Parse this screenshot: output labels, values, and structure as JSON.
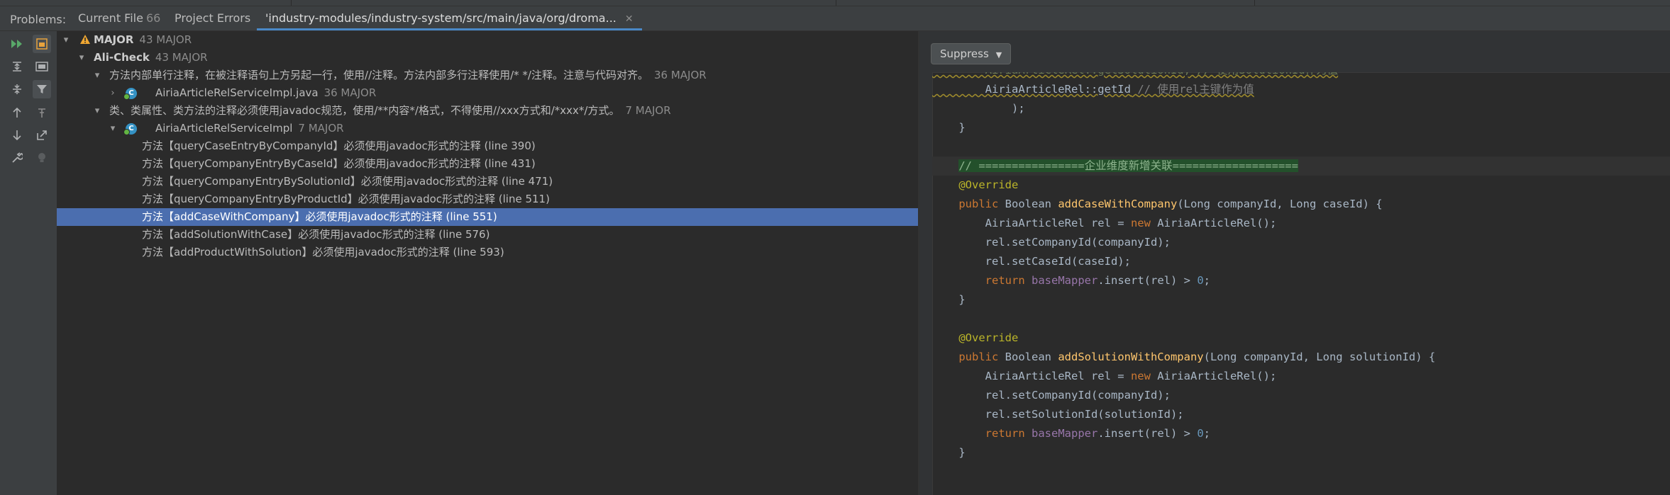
{
  "tabs": {
    "problems_label": "Problems:",
    "current_file": {
      "label": "Current File",
      "count": "66"
    },
    "project_errors": {
      "label": "Project Errors"
    },
    "path_tab": {
      "label": "'industry-modules/industry-system/src/main/java/org/droma...",
      "close": "✕"
    }
  },
  "toolbar": {
    "buttons": [
      "run-icon",
      "preview-icon",
      "expand-all-icon",
      "group-icon",
      "collapse-all-icon",
      "filter-icon",
      "prev-problem-icon",
      "pin-icon",
      "next-problem-icon",
      "export-icon",
      "settings-icon",
      "bulb-icon"
    ]
  },
  "tree": {
    "severity": {
      "label": "MAJOR",
      "count": "43 MAJOR"
    },
    "inspection": {
      "label": "Ali-Check",
      "count": "43 MAJOR"
    },
    "rule1": {
      "label": "方法内部单行注释，在被注释语句上方另起一行，使用//注释。方法内部多行注释使用/* */注释。注意与代码对齐。",
      "count": "36 MAJOR"
    },
    "rule1_file": {
      "label": "AiriaArticleRelServiceImpl.java",
      "count": "36 MAJOR"
    },
    "rule2": {
      "label": "类、类属性、类方法的注释必须使用javadoc规范，使用/**内容*/格式，不得使用//xxx方式和/*xxx*/方式。",
      "count": "7 MAJOR"
    },
    "rule2_class": {
      "label": "AiriaArticleRelServiceImpl",
      "count": "7 MAJOR"
    },
    "problems": [
      {
        "label": "方法【queryCaseEntryByCompanyId】必须使用javadoc形式的注释 (line 390)"
      },
      {
        "label": "方法【queryCompanyEntryByCaseId】必须使用javadoc形式的注释 (line 431)"
      },
      {
        "label": "方法【queryCompanyEntryBySolutionId】必须使用javadoc形式的注释 (line 471)"
      },
      {
        "label": "方法【queryCompanyEntryByProductId】必须使用javadoc形式的注释 (line 511)"
      },
      {
        "label": "方法【addCaseWithCompany】必须使用javadoc形式的注释 (line 551)"
      },
      {
        "label": "方法【addSolutionWithCase】必须使用javadoc形式的注释 (line 576)"
      },
      {
        "label": "方法【addProductWithSolution】必须使用javadoc形式的注释 (line 593)"
      }
    ],
    "selected_index": 4
  },
  "editor": {
    "suppress_label": "Suppress",
    "code": {
      "l0_a": "        AiriaArticleRel::getSolutionId, // 使用SolutionId作为值",
      "l1_a": "        AiriaArticleRel::getId",
      "l1_b": "// 使用rel主键作为值",
      "l2": "    );",
      "l3": "}",
      "l5": "// ================企业维度新增关联===================",
      "l6": "@Override",
      "l7_kw": "public",
      "l7_type": " Boolean ",
      "l7_fn": "addCaseWithCompany",
      "l7_args": "(Long companyId, Long caseId) {",
      "l8_a": "    AiriaArticleRel rel = ",
      "l8_kw": "new",
      "l8_b": " AiriaArticleRel();",
      "l9": "    rel.setCompanyId(companyId);",
      "l10": "    rel.setCaseId(caseId);",
      "l11_kw": "return",
      "l11_fld": "baseMapper",
      "l11_b": ".insert(rel) > ",
      "l11_num": "0",
      "l11_end": ";",
      "l12": "}",
      "l14": "@Override",
      "l15_kw": "public",
      "l15_type": " Boolean ",
      "l15_fn": "addSolutionWithCompany",
      "l15_args": "(Long companyId, Long solutionId) {",
      "l16_a": "    AiriaArticleRel rel = ",
      "l16_kw": "new",
      "l16_b": " AiriaArticleRel();",
      "l17": "    rel.setCompanyId(companyId);",
      "l18": "    rel.setSolutionId(solutionId);",
      "l19_kw": "return",
      "l19_fld": "baseMapper",
      "l19_b": ".insert(rel) > ",
      "l19_num": "0",
      "l19_end": ";",
      "l20": "}"
    }
  }
}
